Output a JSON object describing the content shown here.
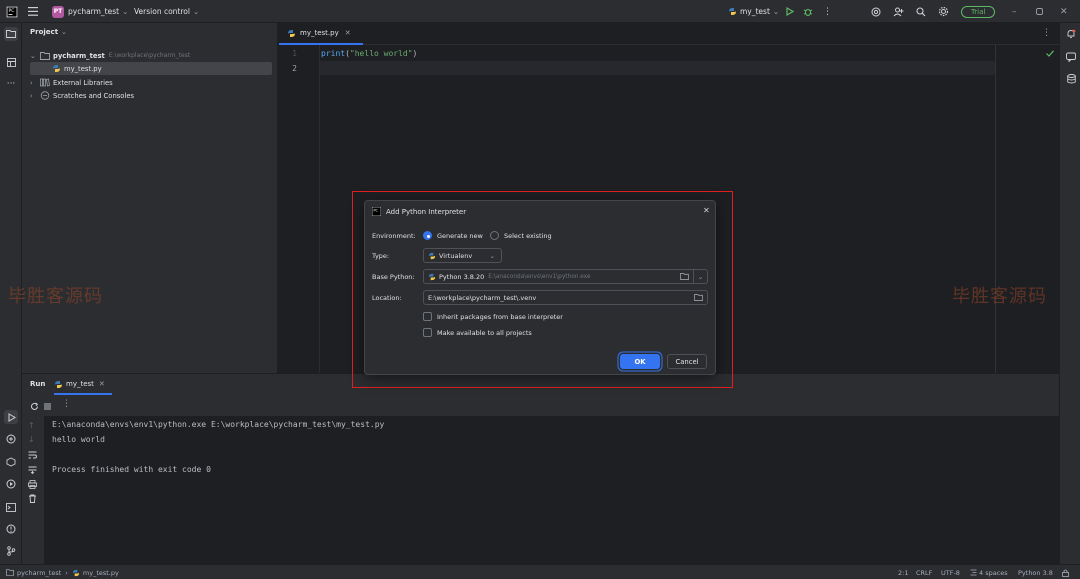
{
  "titlebar": {
    "project_badge": "PT",
    "project_name": "pycharm_test",
    "vcs": "Version control",
    "run_config": "my_test",
    "trial": "Trial"
  },
  "project_panel": {
    "title": "Project",
    "root_name": "pycharm_test",
    "root_path": "E:\\workplace\\pycharm_test",
    "file": "my_test.py",
    "external": "External Libraries",
    "scratches": "Scratches and Consoles"
  },
  "editor": {
    "tab": "my_test.py",
    "lines": [
      {
        "num": "1",
        "fn": "print",
        "open": "(",
        "str": "\"hello world\"",
        "close": ")"
      },
      {
        "num": "2"
      }
    ]
  },
  "run_panel": {
    "title": "Run",
    "tab": "my_test",
    "console": [
      "E:\\anaconda\\envs\\env1\\python.exe E:\\workplace\\pycharm_test\\my_test.py",
      "hello world",
      "",
      "Process finished with exit code 0"
    ]
  },
  "dialog": {
    "title": "Add Python Interpreter",
    "environment_label": "Environment:",
    "generate_new": "Generate new",
    "select_existing": "Select existing",
    "type_label": "Type:",
    "type_value": "Virtualenv",
    "base_python_label": "Base Python:",
    "base_python_version": "Python 3.8.20",
    "base_python_path": "E:\\anaconda\\envs\\env1\\python.exe",
    "location_label": "Location:",
    "location_value": "E:\\workplace\\pycharm_test\\.venv",
    "inherit_label": "Inherit packages from base interpreter",
    "make_available_label": "Make available to all projects",
    "ok": "OK",
    "cancel": "Cancel"
  },
  "statusbar": {
    "crumb_project": "pycharm_test",
    "crumb_file": "my_test.py",
    "position": "2:1",
    "line_sep": "CRLF",
    "encoding": "UTF-8",
    "indent": "4 spaces",
    "interpreter": "Python 3.8"
  },
  "watermark": "毕胜客源码",
  "colors": {
    "accent": "#3574f0",
    "highlight": "#e02020",
    "string": "#6aab73",
    "trial": "#5fb865"
  }
}
